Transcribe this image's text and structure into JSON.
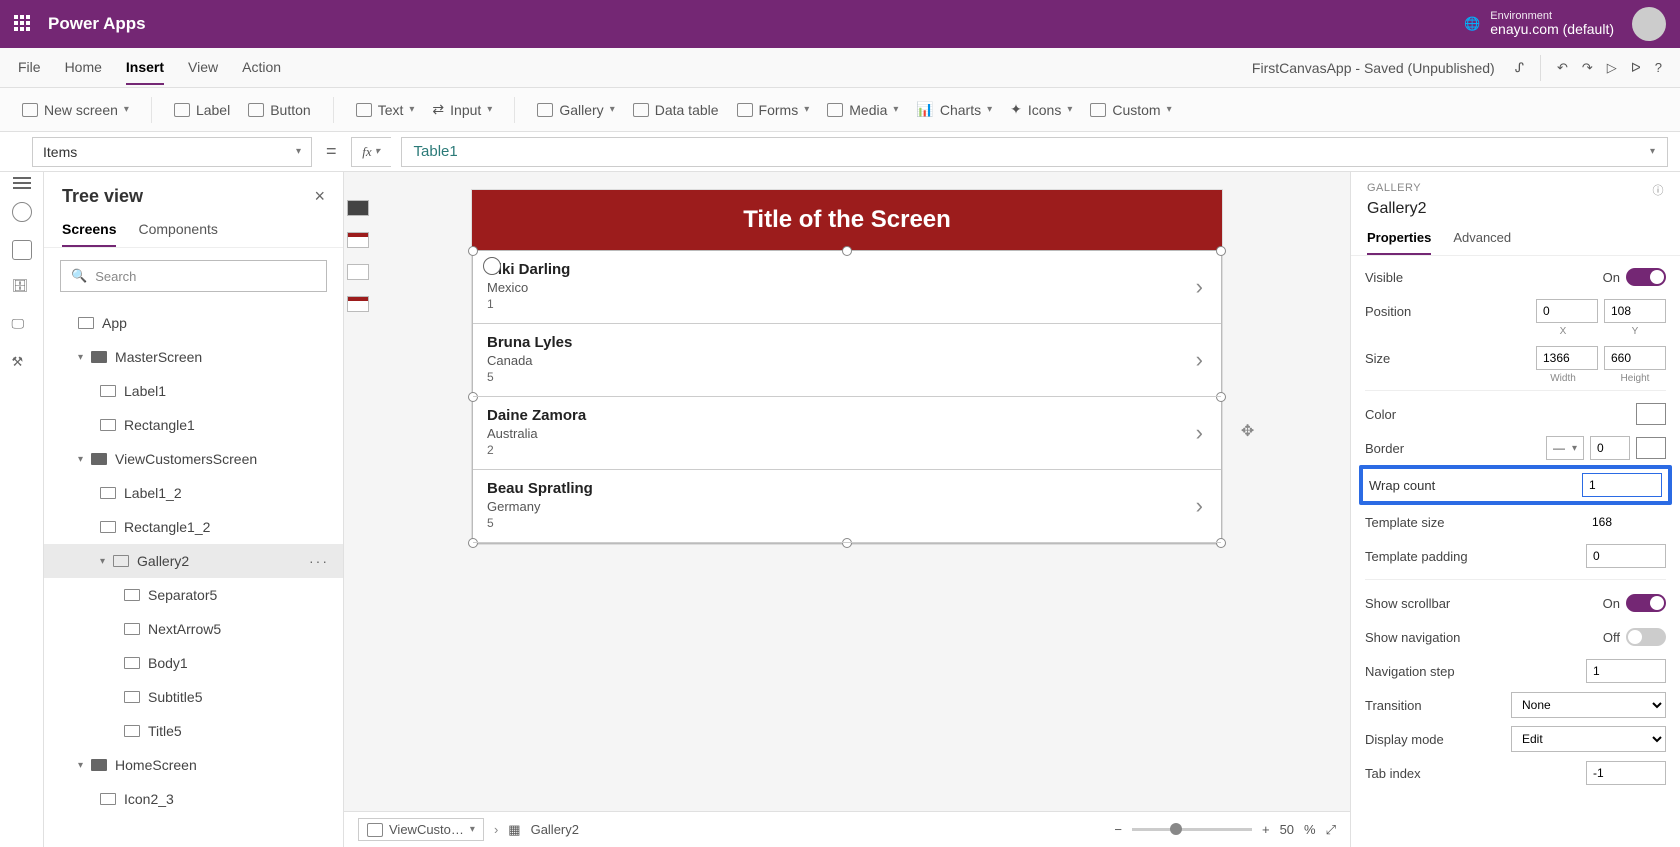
{
  "header": {
    "brand": "Power Apps",
    "env_label": "Environment",
    "env_name": "enayu.com (default)"
  },
  "menubar": {
    "items": [
      "File",
      "Home",
      "Insert",
      "View",
      "Action"
    ],
    "active_index": 2,
    "doc_title": "FirstCanvasApp - Saved (Unpublished)"
  },
  "ribbon": {
    "new_screen": "New screen",
    "label": "Label",
    "button": "Button",
    "text": "Text",
    "input": "Input",
    "gallery": "Gallery",
    "data_table": "Data table",
    "forms": "Forms",
    "media": "Media",
    "charts": "Charts",
    "icons": "Icons",
    "custom": "Custom"
  },
  "formula": {
    "property": "Items",
    "value": "Table1"
  },
  "tree": {
    "title": "Tree view",
    "tabs": [
      "Screens",
      "Components"
    ],
    "active_tab": 0,
    "search_placeholder": "Search",
    "nodes": [
      {
        "label": "App",
        "depth": 1,
        "icon": "app"
      },
      {
        "label": "MasterScreen",
        "depth": 1,
        "icon": "screen",
        "expanded": true
      },
      {
        "label": "Label1",
        "depth": 2,
        "icon": "label"
      },
      {
        "label": "Rectangle1",
        "depth": 2,
        "icon": "rect"
      },
      {
        "label": "ViewCustomersScreen",
        "depth": 1,
        "icon": "screen",
        "expanded": true
      },
      {
        "label": "Label1_2",
        "depth": 2,
        "icon": "label"
      },
      {
        "label": "Rectangle1_2",
        "depth": 2,
        "icon": "rect"
      },
      {
        "label": "Gallery2",
        "depth": 2,
        "icon": "gallery",
        "expanded": true,
        "selected": true
      },
      {
        "label": "Separator5",
        "depth": 3,
        "icon": "sep"
      },
      {
        "label": "NextArrow5",
        "depth": 3,
        "icon": "arrow"
      },
      {
        "label": "Body1",
        "depth": 3,
        "icon": "label"
      },
      {
        "label": "Subtitle5",
        "depth": 3,
        "icon": "label"
      },
      {
        "label": "Title5",
        "depth": 3,
        "icon": "label"
      },
      {
        "label": "HomeScreen",
        "depth": 1,
        "icon": "screen",
        "expanded": true
      },
      {
        "label": "Icon2_3",
        "depth": 2,
        "icon": "icon"
      }
    ]
  },
  "canvas": {
    "screen_title": "Title of the Screen",
    "gallery_rows": [
      {
        "name": "Niki  Darling",
        "sub": "Mexico",
        "num": "1"
      },
      {
        "name": "Bruna  Lyles",
        "sub": "Canada",
        "num": "5"
      },
      {
        "name": "Daine  Zamora",
        "sub": "Australia",
        "num": "2"
      },
      {
        "name": "Beau  Spratling",
        "sub": "Germany",
        "num": "5"
      }
    ],
    "breadcrumb_screen": "ViewCusto…",
    "breadcrumb_ctrl": "Gallery2",
    "zoom_value": "50",
    "zoom_unit": "%"
  },
  "props": {
    "section": "GALLERY",
    "name": "Gallery2",
    "tabs": [
      "Properties",
      "Advanced"
    ],
    "active_tab": 0,
    "visible": {
      "label": "Visible",
      "state": "On"
    },
    "position": {
      "label": "Position",
      "x": "0",
      "y": "108",
      "xl": "X",
      "yl": "Y"
    },
    "size": {
      "label": "Size",
      "w": "1366",
      "h": "660",
      "wl": "Width",
      "hl": "Height"
    },
    "color": {
      "label": "Color"
    },
    "border": {
      "label": "Border",
      "width": "0",
      "color": "#0b1e8a"
    },
    "wrap": {
      "label": "Wrap count",
      "value": "1"
    },
    "tsize": {
      "label": "Template size",
      "value": "168"
    },
    "tpad": {
      "label": "Template padding",
      "value": "0"
    },
    "scroll": {
      "label": "Show scrollbar",
      "state": "On"
    },
    "nav": {
      "label": "Show navigation",
      "state": "Off"
    },
    "navstep": {
      "label": "Navigation step",
      "value": "1"
    },
    "transition": {
      "label": "Transition",
      "value": "None"
    },
    "dispmode": {
      "label": "Display mode",
      "value": "Edit"
    },
    "tabindex": {
      "label": "Tab index",
      "value": "-1"
    }
  }
}
